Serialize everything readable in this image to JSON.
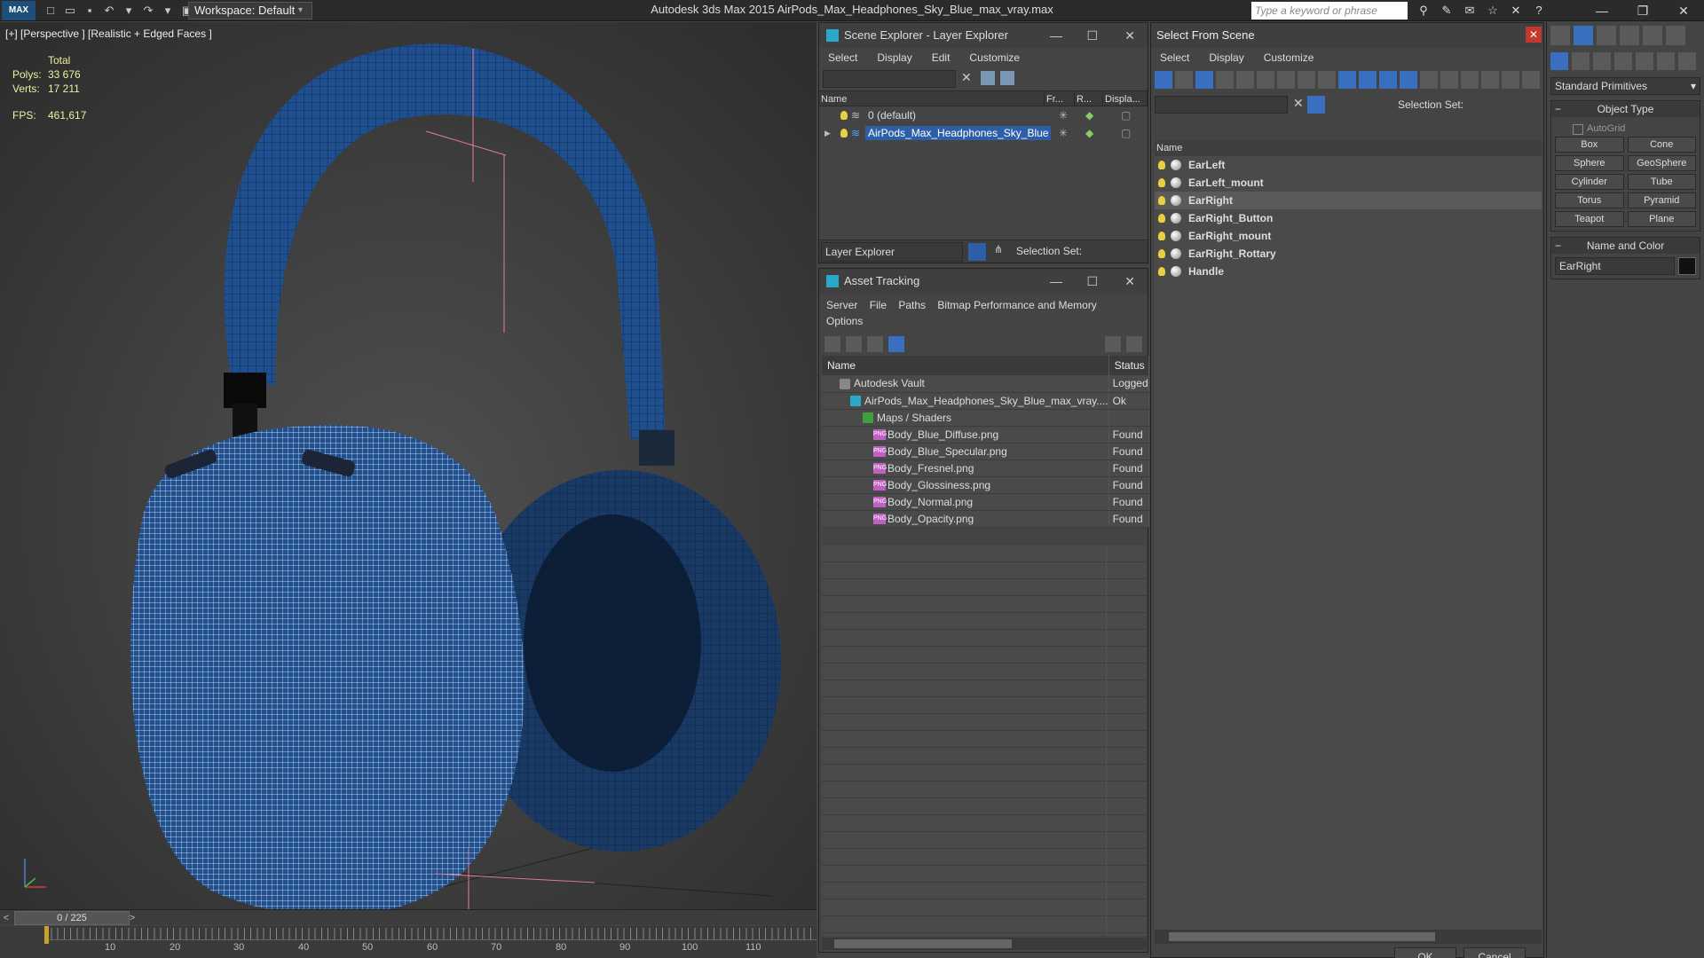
{
  "app": {
    "title": "Autodesk 3ds Max  2015      AirPods_Max_Headphones_Sky_Blue_max_vray.max",
    "logo": "MAX",
    "workspace": "Workspace: Default",
    "search_placeholder": "Type a keyword or phrase"
  },
  "viewport": {
    "label": "[+] [Perspective ] [Realistic + Edged Faces ]",
    "stats": {
      "total_label": "Total",
      "polys_label": "Polys:",
      "polys_value": "33 676",
      "verts_label": "Verts:",
      "verts_value": "17 211",
      "fps_label": "FPS:",
      "fps_value": "461,617"
    }
  },
  "timeline": {
    "frame": "0 / 225",
    "ticks": [
      "10",
      "20",
      "30",
      "40",
      "50",
      "60",
      "70",
      "80",
      "90",
      "100",
      "110"
    ]
  },
  "scene_explorer": {
    "title": "Scene Explorer - Layer Explorer",
    "menu": [
      "Select",
      "Display",
      "Edit",
      "Customize"
    ],
    "columns": [
      "Name",
      "Fr...",
      "R...",
      "Displa..."
    ],
    "rows": [
      {
        "name": "0 (default)",
        "selected": false
      },
      {
        "name": "AirPods_Max_Headphones_Sky_Blue",
        "selected": true
      }
    ],
    "bottom_dropdown": "Layer Explorer",
    "selection_set_label": "Selection Set:"
  },
  "asset_tracking": {
    "title": "Asset Tracking",
    "menu_line1": [
      "Server",
      "File",
      "Paths",
      "Bitmap Performance and Memory"
    ],
    "menu_line2": [
      "Options"
    ],
    "columns": [
      "Name",
      "Status"
    ],
    "rows": [
      {
        "name": "Autodesk Vault",
        "status": "Logged",
        "indent": 0,
        "icon": "vault"
      },
      {
        "name": "AirPods_Max_Headphones_Sky_Blue_max_vray....",
        "status": "Ok",
        "indent": 1,
        "icon": "file"
      },
      {
        "name": "Maps / Shaders",
        "status": "",
        "indent": 2,
        "icon": "group"
      },
      {
        "name": "Body_Blue_Diffuse.png",
        "status": "Found",
        "indent": 3,
        "icon": "png"
      },
      {
        "name": "Body_Blue_Specular.png",
        "status": "Found",
        "indent": 3,
        "icon": "png"
      },
      {
        "name": "Body_Fresnel.png",
        "status": "Found",
        "indent": 3,
        "icon": "png"
      },
      {
        "name": "Body_Glossiness.png",
        "status": "Found",
        "indent": 3,
        "icon": "png"
      },
      {
        "name": "Body_Normal.png",
        "status": "Found",
        "indent": 3,
        "icon": "png"
      },
      {
        "name": "Body_Opacity.png",
        "status": "Found",
        "indent": 3,
        "icon": "png"
      }
    ]
  },
  "select_from_scene": {
    "title": "Select From Scene",
    "menu": [
      "Select",
      "Display",
      "Customize"
    ],
    "selection_set_label": "Selection Set:",
    "column": "Name",
    "objects": [
      {
        "name": "EarLeft",
        "selected": false
      },
      {
        "name": "EarLeft_mount",
        "selected": false
      },
      {
        "name": "EarRight",
        "selected": true
      },
      {
        "name": "EarRight_Button",
        "selected": false
      },
      {
        "name": "EarRight_mount",
        "selected": false
      },
      {
        "name": "EarRight_Rottary",
        "selected": false
      },
      {
        "name": "Handle",
        "selected": false
      }
    ],
    "ok_label": "OK",
    "cancel_label": "Cancel"
  },
  "command_panel": {
    "dropdown": "Standard Primitives",
    "object_type_title": "Object Type",
    "autogrid_label": "AutoGrid",
    "buttons": [
      "Box",
      "Cone",
      "Sphere",
      "GeoSphere",
      "Cylinder",
      "Tube",
      "Torus",
      "Pyramid",
      "Teapot",
      "Plane"
    ],
    "name_color_title": "Name and Color",
    "object_name": "EarRight"
  },
  "colors": {
    "selection_blue": "#2c5fa8",
    "headphone_blue": "#1f4f8f",
    "viewport_bg": "#4e4e4e"
  }
}
